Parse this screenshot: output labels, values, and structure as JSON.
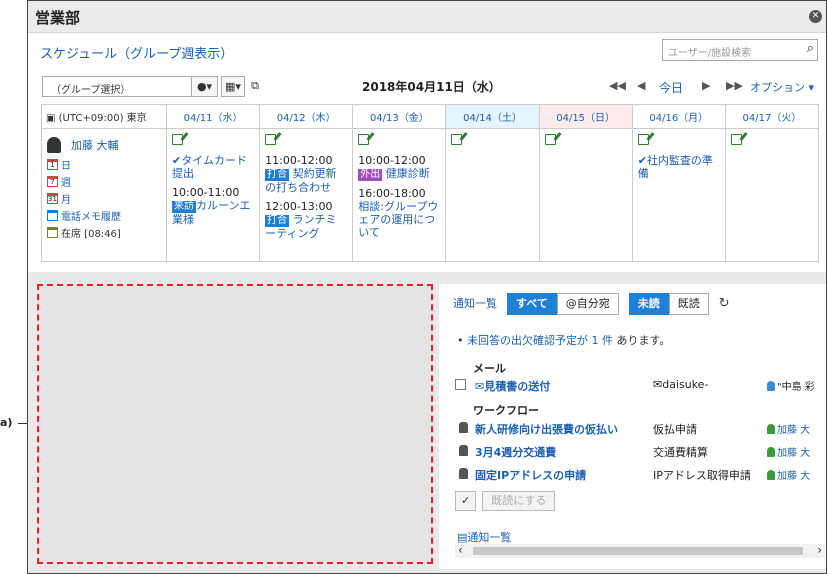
{
  "window": {
    "title": "営業部"
  },
  "schedule": {
    "title": "スケジュール（グループ週表示）",
    "search_placeholder": "ユーザー/施設検索",
    "group_select": "（グループ選択）",
    "date": "2018年04月11日（水）",
    "today": "今日",
    "options": "オプション ▾",
    "timezone": "(UTC+09:00) 東京",
    "days": [
      "04/11（水）",
      "04/12（木）",
      "04/13（金）",
      "04/14（土）",
      "04/15（日）",
      "04/16（月）",
      "04/17（火）"
    ],
    "user": {
      "name": "加藤 大輔",
      "links": [
        "日",
        "週",
        "月",
        "電話メモ履歴",
        "在席 [08:46]"
      ]
    },
    "events": {
      "d0a": "タイムカード提出",
      "d0b_time": "10:00-11:00",
      "d0b_tag": "来訪",
      "d0b_text": "カルーンエ業様",
      "d1a_time": "11:00-12:00",
      "d1a_tag": "打合",
      "d1a_text": "契約更新の打ち合わせ",
      "d1b_time": "12:00-13:00",
      "d1b_tag": "打合",
      "d1b_text": "ランチミーティング",
      "d2a_time": "10:00-12:00",
      "d2a_tag": "外出",
      "d2a_text": "健康診断",
      "d2b_time": "16:00-18:00",
      "d2b_text": "相談:グループウェアの運用について",
      "d5a": "社内監査の準備"
    }
  },
  "notifications": {
    "title": "通知一覧",
    "tabs": [
      "すべて",
      "@自分宛"
    ],
    "filters": [
      "未読",
      "既読"
    ],
    "unanswered_pre": "未回答の出欠確認予定が",
    "unanswered_count": "1 件",
    "unanswered_post": "あります。",
    "mail_label": "メール",
    "mail": {
      "subject": "見積書の送付",
      "from": "daisuke-",
      "to": "\"中島 彩"
    },
    "workflow_label": "ワークフロー",
    "workflow": [
      {
        "subject": "新人研修向け出張費の仮払い",
        "type": "仮払申請",
        "who": "加藤 大"
      },
      {
        "subject": "3月4週分交通費",
        "type": "交通費精算",
        "who": "加藤 大"
      },
      {
        "subject": "固定IPアドレスの申請",
        "type": "IPアドレス取得申請",
        "who": "加藤 大"
      }
    ],
    "mark_read": "既読にする",
    "footer_link": "通知一覧"
  },
  "callout": "a)"
}
